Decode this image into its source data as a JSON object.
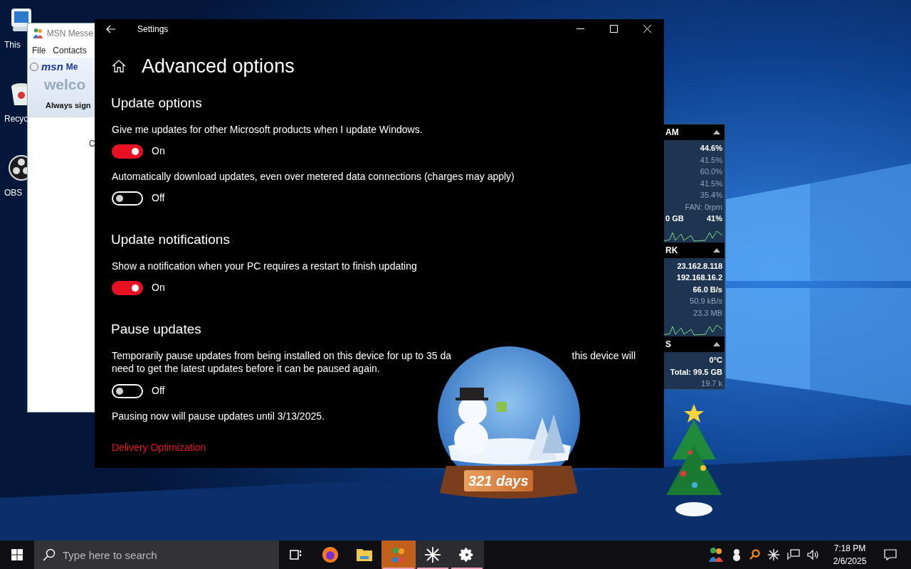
{
  "desktop_icons": [
    {
      "label": "This",
      "kind": "computer"
    },
    {
      "label": "Recyc",
      "kind": "bin"
    },
    {
      "label": "OBS",
      "kind": "obs"
    }
  ],
  "msn_window": {
    "title": "MSN Messe",
    "menu": [
      "File",
      "Contacts"
    ],
    "logo": "msn",
    "logo_suffix": "Me",
    "welcome": "welco",
    "sign_in": "Always sign",
    "body_text": "C"
  },
  "settings_window": {
    "title": "Settings",
    "heading": "Advanced options",
    "sections": [
      {
        "title": "Update options",
        "items": [
          {
            "kind": "toggle",
            "label": "Give me updates for other Microsoft products when I update Windows.",
            "on": true,
            "state_text": "On"
          },
          {
            "kind": "toggle",
            "label": "Automatically download updates, even over metered data connections (charges may apply)",
            "on": false,
            "state_text": "Off"
          }
        ]
      },
      {
        "title": "Update notifications",
        "items": [
          {
            "kind": "toggle",
            "label": "Show a notification when your PC requires a restart to finish updating",
            "on": true,
            "state_text": "On"
          }
        ]
      },
      {
        "title": "Pause updates",
        "items": [
          {
            "kind": "split_text",
            "parts": [
              "Temporarily pause updates from being installed on this device for up to 35 da",
              "this device will"
            ]
          },
          {
            "kind": "text",
            "text": "need to get the latest updates before it can be paused again."
          },
          {
            "kind": "toggle",
            "on": false,
            "state_text": "Off"
          },
          {
            "kind": "text",
            "text": "Pausing now will pause updates until 3/13/2025."
          },
          {
            "kind": "link",
            "text": "Delivery Optimization"
          }
        ]
      }
    ]
  },
  "monitor_gadget": {
    "panels": [
      {
        "title": "AM",
        "rows": [
          {
            "text": "44.6%",
            "kind": "bold"
          },
          {
            "text": "41.5%",
            "kind": "dim"
          },
          {
            "text": "60.0%",
            "kind": "dim"
          },
          {
            "text": "41.5%",
            "kind": "dim"
          },
          {
            "text": "35.4%",
            "kind": "dim"
          },
          {
            "text": "FAN: 0rpm",
            "kind": "dim"
          },
          {
            "text": "0 GB",
            "kind": "split",
            "extra": "41%"
          }
        ],
        "graph": true
      },
      {
        "title": "RK",
        "rows": [
          {
            "text": "23.162.8.118",
            "kind": "bold"
          },
          {
            "text": "192.168.16.2",
            "kind": "bold"
          },
          {
            "text": "66.0 B/s",
            "kind": "bold"
          },
          {
            "text": "50.9 kB/s",
            "kind": "dim"
          },
          {
            "text": "23.3 MB",
            "kind": "dim"
          }
        ],
        "graph": true
      },
      {
        "title": "S",
        "rows": [
          {
            "text": "0°C",
            "kind": "bold"
          },
          {
            "text": "Total: 99.5 GB",
            "kind": "bold"
          },
          {
            "text": "19.7 k",
            "kind": "dim"
          }
        ],
        "graph": false
      }
    ]
  },
  "snow_globe": {
    "counter": "321 days"
  },
  "taskbar": {
    "search": {
      "placeholder": "Type here to search"
    },
    "apps": [
      {
        "kind": "taskview",
        "running": false,
        "selected": false
      },
      {
        "kind": "firefox",
        "running": false,
        "selected": false
      },
      {
        "kind": "folder",
        "running": false,
        "selected": false
      },
      {
        "kind": "messenger",
        "running": true,
        "selected": true
      },
      {
        "kind": "star",
        "running": true,
        "selected": false
      },
      {
        "kind": "gear",
        "running": true,
        "selected": false
      }
    ],
    "time": "7:18 PM",
    "date": "2/6/2025"
  }
}
